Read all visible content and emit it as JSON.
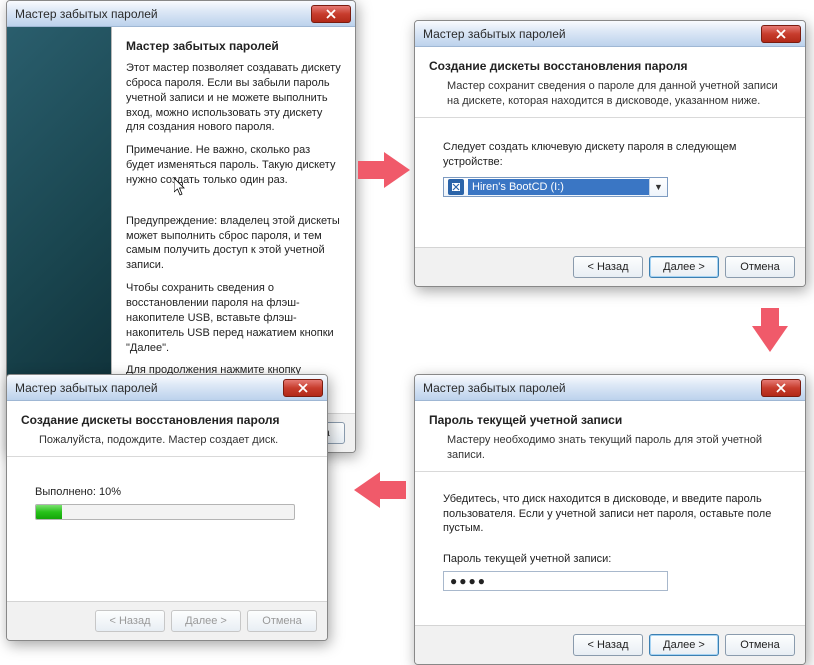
{
  "common": {
    "window_title": "Мастер забытых паролей",
    "btn_back": "< Назад",
    "btn_next": "Далее >",
    "btn_cancel": "Отмена",
    "close_icon": "X"
  },
  "step1": {
    "heading": "Мастер забытых паролей",
    "para1": "Этот мастер позволяет создавать дискету сброса пароля. Если вы забыли пароль учетной записи и не можете выполнить вход, можно использовать эту дискету для создания нового пароля.",
    "para2": "Примечание. Не важно, сколько раз будет изменяться пароль. Такую дискету нужно создать только один раз.",
    "warn1": "Предупреждение: владелец этой дискеты может выполнить сброс пароля, и тем самым получить доступ к этой учетной записи.",
    "warn2": "Чтобы сохранить сведения о восстановлении пароля на флэш-накопителе USB, вставьте флэш-накопитель USB перед нажатием кнопки \"Далее\".",
    "cont": "Для продолжения нажмите кнопку \"Далее\"."
  },
  "step2": {
    "heading": "Создание дискеты восстановления пароля",
    "sub": "Мастер сохранит сведения о пароле для данной учетной записи на дискете, которая находится в дисководе, указанном ниже.",
    "prompt": "Следует создать ключевую дискету пароля в следующем устройстве:",
    "select_value": "Hiren's BootCD (I:)"
  },
  "step3": {
    "heading": "Пароль текущей учетной записи",
    "sub": "Мастеру необходимо знать текущий пароль для этой учетной записи.",
    "prompt": "Убедитесь, что диск находится в дисководе, и введите пароль пользователя. Если у учетной записи нет пароля, оставьте поле пустым.",
    "label": "Пароль текущей учетной записи:",
    "value_masked": "●●●●"
  },
  "step4": {
    "heading": "Создание дискеты восстановления пароля",
    "sub": "Пожалуйста, подождите. Мастер создает диск.",
    "progress_label": "Выполнено: 10%",
    "progress_pct": 10
  }
}
